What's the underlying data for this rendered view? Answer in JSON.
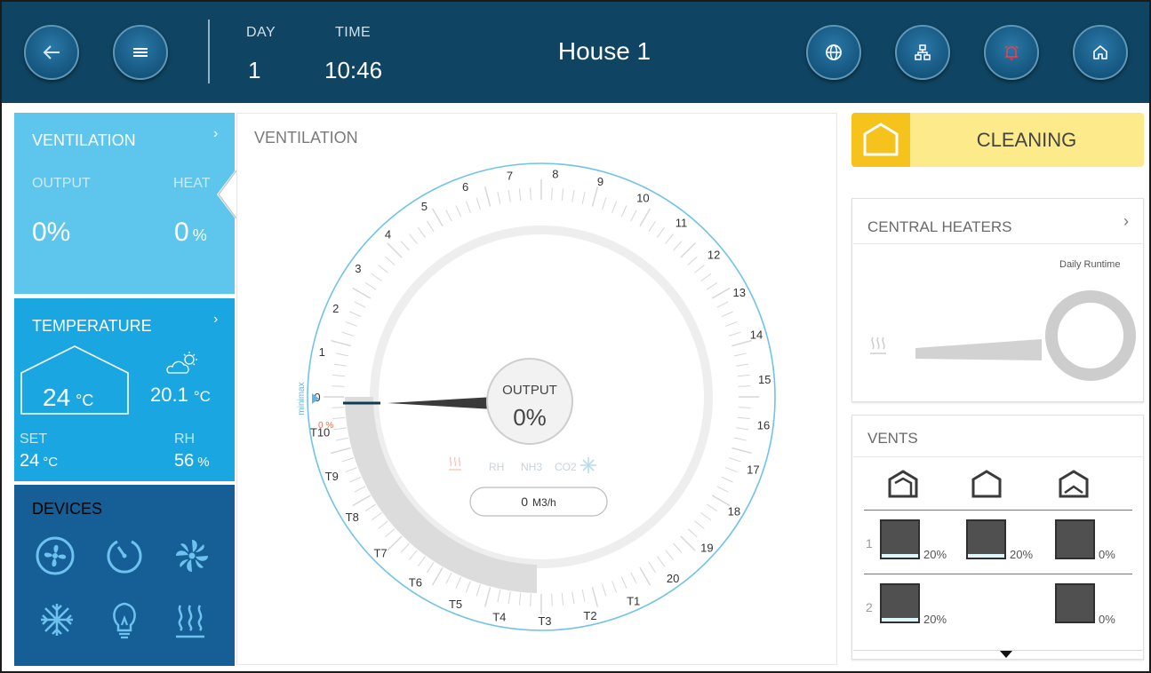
{
  "header": {
    "day_label": "DAY",
    "day_value": "1",
    "time_label": "TIME",
    "time_value": "10:46",
    "title": "House 1"
  },
  "left": {
    "ventilation": {
      "title": "VENTILATION",
      "output_label": "OUTPUT",
      "heat_label": "HEAT",
      "output_value": "0%",
      "heat_value": "0",
      "heat_unit": "%"
    },
    "temperature": {
      "title": "TEMPERATURE",
      "inside_value": "24",
      "inside_unit": "°C",
      "outside_value": "20.1",
      "outside_unit": "°C",
      "set_label": "SET",
      "set_value": "24",
      "set_unit": "°C",
      "rh_label": "RH",
      "rh_value": "56",
      "rh_unit": "%"
    },
    "devices": {
      "title": "DEVICES"
    }
  },
  "main": {
    "title": "VENTILATION",
    "dial_labels": [
      "0",
      "1",
      "2",
      "3",
      "4",
      "5",
      "6",
      "7",
      "8",
      "9",
      "10",
      "11",
      "12",
      "13",
      "14",
      "15",
      "16",
      "17",
      "18",
      "19",
      "20",
      "T1",
      "T2",
      "T3",
      "T4",
      "T5",
      "T6",
      "T7",
      "T8",
      "T9",
      "T10"
    ],
    "output_label": "OUTPUT",
    "output_value": "0%",
    "red_zero": "0 %",
    "vert_label": "minimax",
    "sensor_labels": [
      "RH",
      "NH3",
      "CO2"
    ],
    "flow_value": "0",
    "flow_unit": "M3/h"
  },
  "status": {
    "label": "CLEANING"
  },
  "central_heaters": {
    "title": "CENTRAL HEATERS",
    "runtime_label": "Daily Runtime"
  },
  "vents": {
    "title": "VENTS",
    "rows": [
      {
        "index": "1",
        "items": [
          {
            "level": 20,
            "label": "20%"
          },
          {
            "level": 20,
            "label": "20%"
          },
          {
            "level": 0,
            "label": "0%"
          }
        ]
      },
      {
        "index": "2",
        "items": [
          {
            "level": 20,
            "label": "20%"
          },
          {
            "level": 0,
            "label": "0%"
          }
        ]
      }
    ]
  },
  "colors": {
    "topbar": "#0f4562",
    "ventilation_panel": "#5ec6ec",
    "temperature_panel": "#1aa6e0",
    "devices_panel": "#155f96",
    "status_yellow": "#fdea8a"
  }
}
